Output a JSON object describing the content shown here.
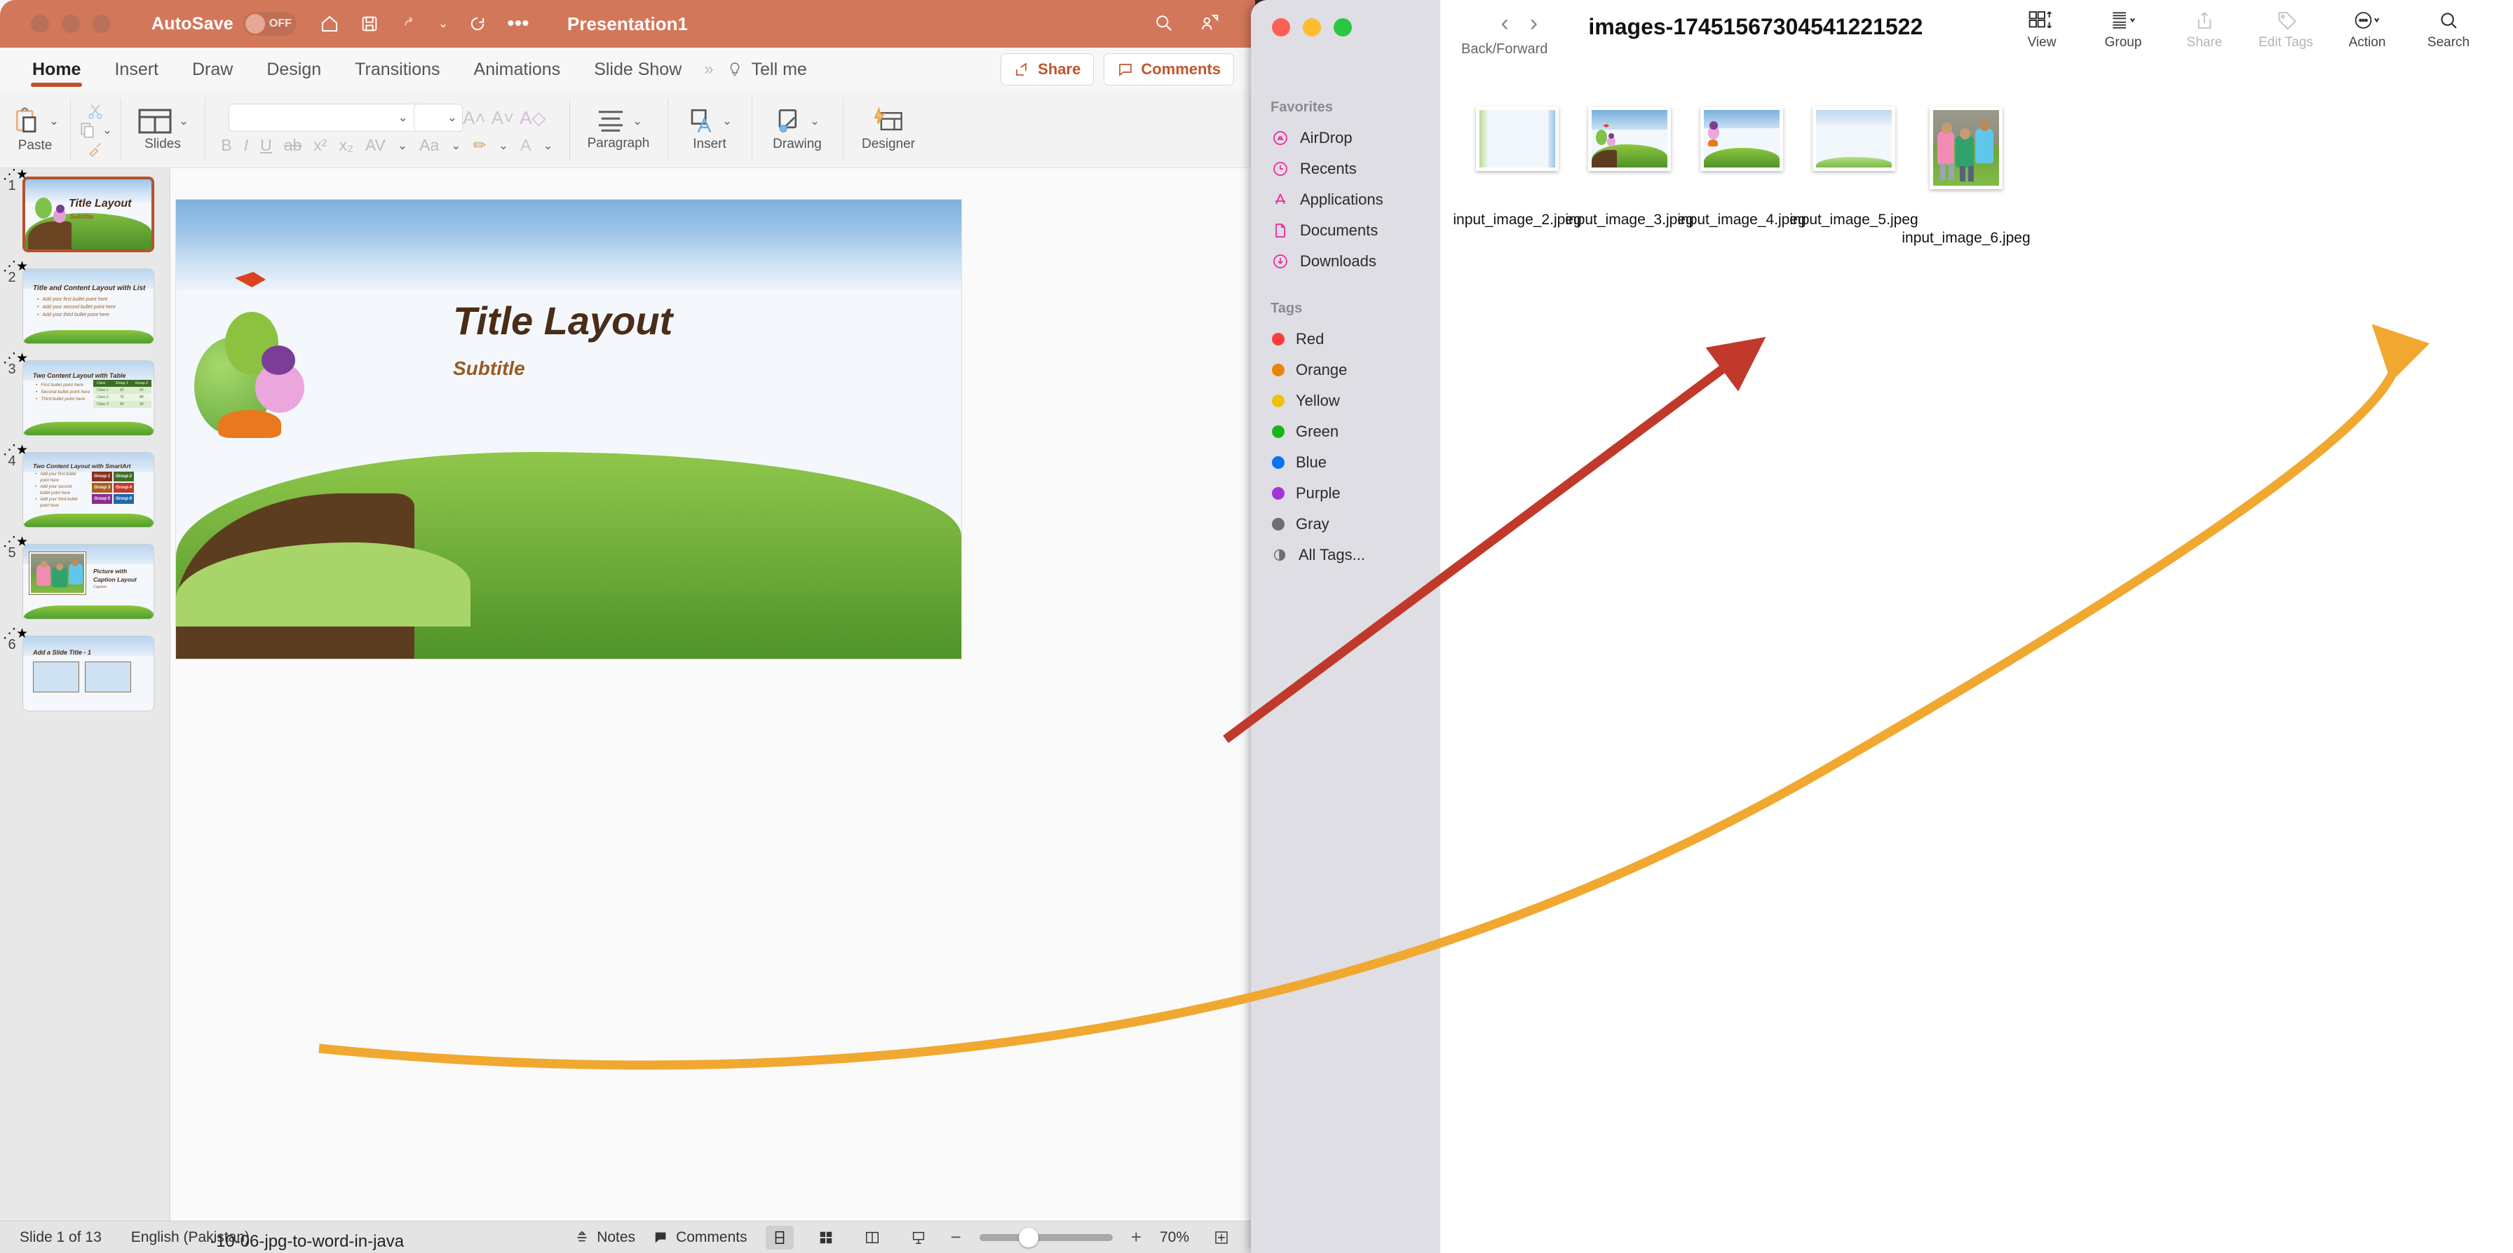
{
  "powerpoint": {
    "titlebar": {
      "autosave_label": "AutoSave",
      "autosave_state": "OFF",
      "document_title": "Presentation1",
      "quick_access": [
        "home-icon",
        "save-icon",
        "undo-icon",
        "undo-dropdown-icon",
        "redo-icon",
        "more-icon"
      ],
      "right_icons": [
        "search-icon",
        "collaborators-icon"
      ]
    },
    "ribbon_tabs": [
      {
        "label": "Home",
        "active": true
      },
      {
        "label": "Insert",
        "active": false
      },
      {
        "label": "Draw",
        "active": false
      },
      {
        "label": "Design",
        "active": false
      },
      {
        "label": "Transitions",
        "active": false
      },
      {
        "label": "Animations",
        "active": false
      },
      {
        "label": "Slide Show",
        "active": false
      }
    ],
    "tell_me": "Tell me",
    "share_label": "Share",
    "comments_label": "Comments",
    "ribbon_groups": [
      {
        "label": "Paste"
      },
      {
        "label": "Slides"
      },
      {
        "label": "Paragraph"
      },
      {
        "label": "Insert"
      },
      {
        "label": "Drawing"
      },
      {
        "label": "Designer"
      }
    ],
    "font_box_value": "",
    "font_size_value": "",
    "format_buttons": [
      "B",
      "I",
      "U",
      "ab",
      "x²",
      "x₂",
      "AV",
      "Aa"
    ],
    "slides": [
      {
        "number": "1",
        "title": "Title Layout",
        "subtitle": "Subtitle",
        "type": "title",
        "selected": true
      },
      {
        "number": "2",
        "title": "Title and Content Layout with List",
        "type": "bullets",
        "bullets": [
          "Add your first bullet point here",
          "Add your second bullet point here",
          "Add your third bullet point here"
        ]
      },
      {
        "number": "3",
        "title": "Two Content Layout with Table",
        "type": "table",
        "bullets": [
          "First bullet point here",
          "Second bullet point here",
          "Third bullet point here"
        ],
        "table": {
          "headers": [
            "Class",
            "Group 1",
            "Group 2"
          ],
          "rows": [
            [
              "Class 1",
              "82",
              "95"
            ],
            [
              "Class 2",
              "76",
              "88"
            ],
            [
              "Class 3",
              "84",
              "90"
            ]
          ]
        }
      },
      {
        "number": "4",
        "title": "Two Content Layout with SmartArt",
        "type": "smartart",
        "bullets": [
          "Add your first bullet point here",
          "Add your second bullet point here",
          "Add your third bullet point here"
        ],
        "groups": [
          {
            "label": "Group 1",
            "color": "#8b2f1e"
          },
          {
            "label": "Group 2",
            "color": "#3c6e25"
          },
          {
            "label": "Group 3",
            "color": "#a8601f"
          },
          {
            "label": "Group 4",
            "color": "#c0392b"
          },
          {
            "label": "Group 5",
            "color": "#8e2c8e"
          },
          {
            "label": "Group 6",
            "color": "#2069a8"
          }
        ]
      },
      {
        "number": "5",
        "title": "Picture with Caption Layout",
        "caption": "Caption",
        "type": "picture"
      },
      {
        "number": "6",
        "title": "Add a Slide Title - 1",
        "type": "two-placeholder"
      }
    ],
    "main_slide": {
      "title": "Title Layout",
      "subtitle": "Subtitle"
    },
    "status": {
      "slide_counter": "Slide 1 of 13",
      "language": "English (Pakistan)",
      "notes_label": "Notes",
      "comments_label": "Comments",
      "zoom_level": "70%",
      "zoom_minus": "−",
      "zoom_plus": "+",
      "view_icons": [
        "normal-view-icon",
        "slide-sorter-icon",
        "reading-view-icon",
        "slideshow-icon"
      ],
      "fit_icon": "fit-to-window-icon"
    },
    "background_text": "-10-06-jpg-to-word-in-java"
  },
  "finder": {
    "traffic_lights": [
      "close",
      "minimize",
      "zoom"
    ],
    "nav_label": "Back/Forward",
    "folder_title": "images-17451567304541221522",
    "toolbar": [
      {
        "label": "View",
        "icon": "grid-view-icon",
        "dim": false
      },
      {
        "label": "Group",
        "icon": "group-icon",
        "dim": false
      },
      {
        "label": "Share",
        "icon": "share-icon",
        "dim": true
      },
      {
        "label": "Edit Tags",
        "icon": "tag-icon",
        "dim": true
      },
      {
        "label": "Action",
        "icon": "action-icon",
        "dim": false
      },
      {
        "label": "Search",
        "icon": "search-icon",
        "dim": false
      }
    ],
    "sidebar": {
      "favorites_header": "Favorites",
      "favorites": [
        {
          "label": "AirDrop",
          "icon": "airdrop-icon"
        },
        {
          "label": "Recents",
          "icon": "clock-icon"
        },
        {
          "label": "Applications",
          "icon": "applications-icon"
        },
        {
          "label": "Documents",
          "icon": "document-icon"
        },
        {
          "label": "Downloads",
          "icon": "download-icon"
        }
      ],
      "tags_header": "Tags",
      "tags": [
        {
          "label": "Red",
          "color": "#fc3d39"
        },
        {
          "label": "Orange",
          "color": "#e8850c"
        },
        {
          "label": "Yellow",
          "color": "#efc00c"
        },
        {
          "label": "Green",
          "color": "#18b51b"
        },
        {
          "label": "Blue",
          "color": "#0a72f5"
        },
        {
          "label": "Purple",
          "color": "#a334da"
        },
        {
          "label": "Gray",
          "color": "#6e6e73"
        }
      ],
      "all_tags_label": "All Tags...",
      "all_tags_icon": "all-tags-icon"
    },
    "files": [
      {
        "name": "input_image_2.jpeg",
        "kind": "slide-blank"
      },
      {
        "name": "input_image_3.jpeg",
        "kind": "slide-scene"
      },
      {
        "name": "input_image_4.jpeg",
        "kind": "slide-tree"
      },
      {
        "name": "input_image_5.jpeg",
        "kind": "slide-hills"
      },
      {
        "name": "input_image_6.jpeg",
        "kind": "photo-kids"
      }
    ]
  },
  "annotations": {
    "arrow_red_color": "#c0392b",
    "arrow_orange_color": "#f0a830"
  }
}
